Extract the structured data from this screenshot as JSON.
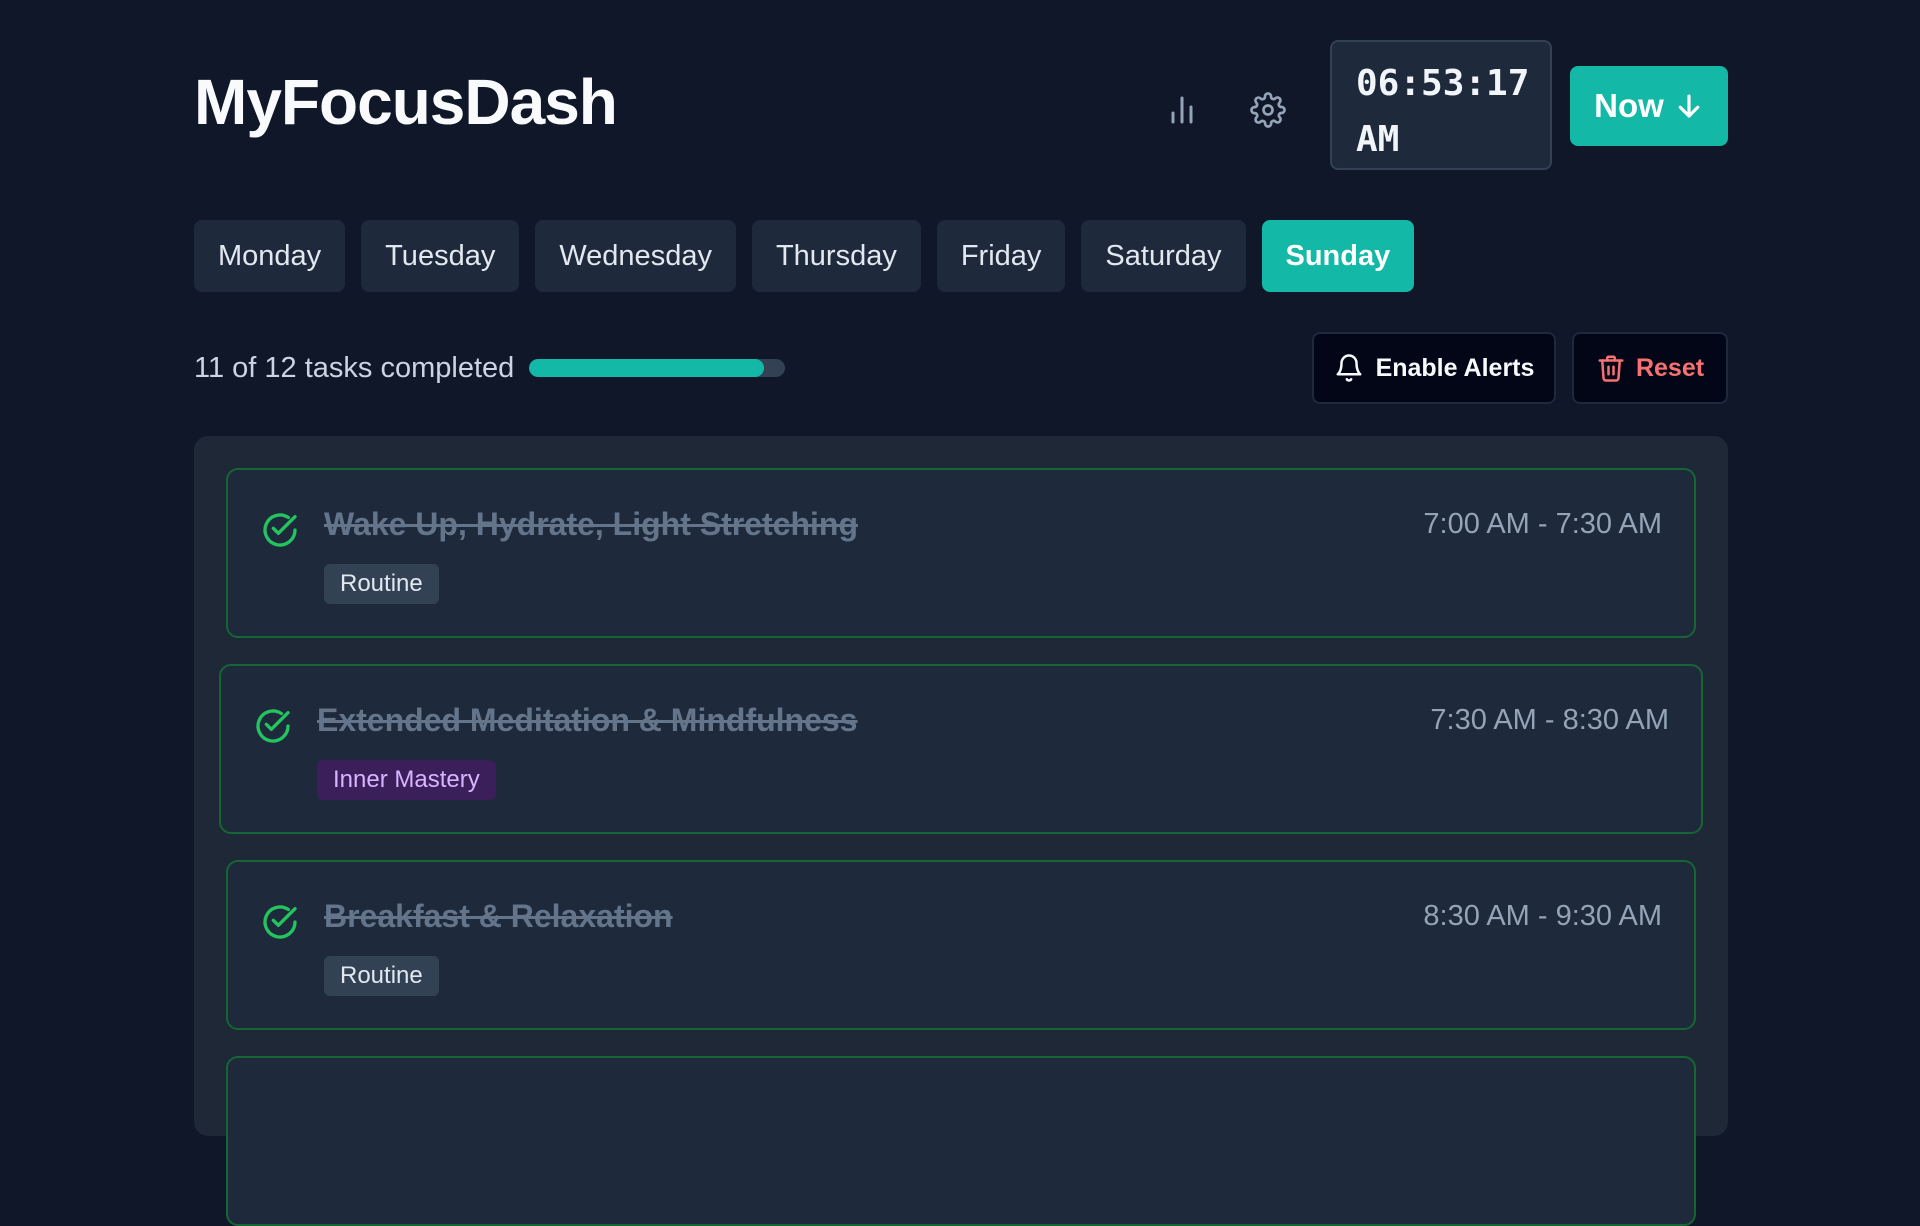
{
  "app": {
    "title": "MyFocusDash",
    "clock": "06:53:17 AM",
    "now_label": "Now"
  },
  "icons": {
    "stats": "bar-chart-icon",
    "settings": "gear-icon",
    "now": "arrow-down-icon",
    "alerts": "bell-icon",
    "reset": "trash-icon",
    "check": "check-circle-icon"
  },
  "colors": {
    "accent": "#14b8a6",
    "background": "#0f1729",
    "danger": "#f87171",
    "complete_border": "#166534",
    "check": "#22c55e"
  },
  "days": [
    {
      "label": "Monday",
      "active": false
    },
    {
      "label": "Tuesday",
      "active": false
    },
    {
      "label": "Wednesday",
      "active": false
    },
    {
      "label": "Thursday",
      "active": false
    },
    {
      "label": "Friday",
      "active": false
    },
    {
      "label": "Saturday",
      "active": false
    },
    {
      "label": "Sunday",
      "active": true
    }
  ],
  "progress": {
    "text": "11 of 12 tasks completed",
    "completed": 11,
    "total": 12,
    "fraction": 0.917
  },
  "actions": {
    "alerts_label": "Enable Alerts",
    "reset_label": "Reset"
  },
  "tasks": [
    {
      "title": "Wake Up, Hydrate, Light Stretching",
      "time": "7:00 AM - 7:30 AM",
      "tag": "Routine",
      "done": true
    },
    {
      "title": "Extended Meditation & Mindfulness",
      "time": "7:30 AM - 8:30 AM",
      "tag": "Inner Mastery",
      "done": true
    },
    {
      "title": "Breakfast & Relaxation",
      "time": "8:30 AM - 9:30 AM",
      "tag": "Routine",
      "done": true
    }
  ]
}
